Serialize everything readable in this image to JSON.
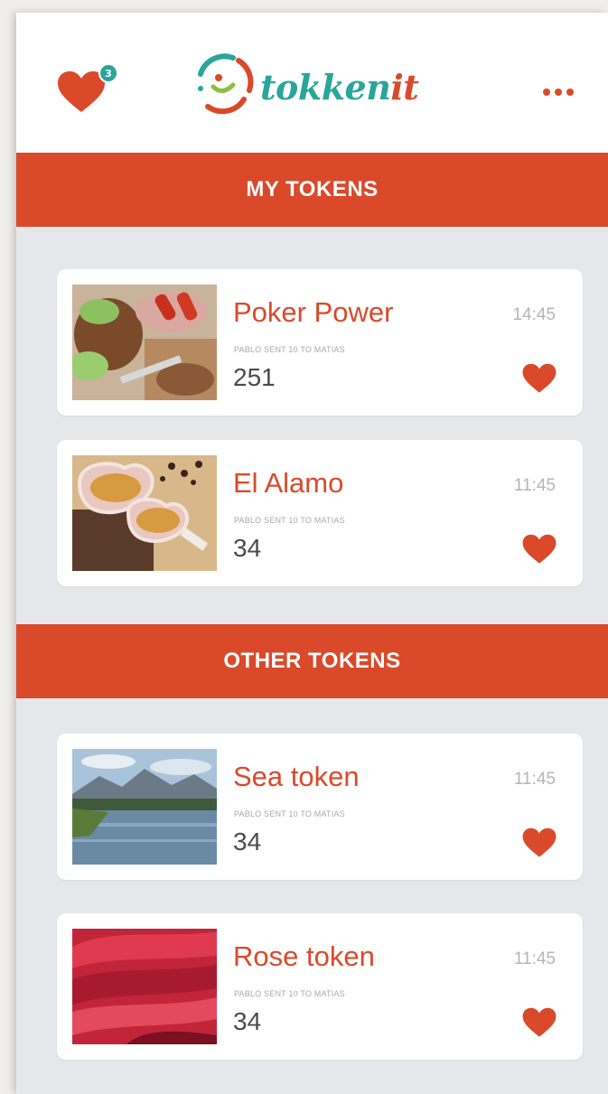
{
  "header": {
    "favorites_count": "3",
    "logo_text_main": "tokken",
    "logo_text_accent": "it",
    "icons": {
      "favorites": "heart-icon",
      "menu": "more-dots-icon"
    },
    "colors": {
      "accent": "#d9492a",
      "teal": "#2aa59a"
    }
  },
  "sections": {
    "my_tokens_label": "MY TOKENS",
    "other_tokens_label": "OTHER TOKENS"
  },
  "cards": [
    {
      "title": "Poker Power",
      "time": "14:45",
      "subtitle": "PABLO SENT 10 TO MATIAS",
      "count": "251"
    },
    {
      "title": "El Alamo",
      "time": "11:45",
      "subtitle": "PABLO SENT 10 TO MATIAS",
      "count": "34"
    },
    {
      "title": "Sea token",
      "time": "11:45",
      "subtitle": "PABLO SENT 10 TO MATIAS",
      "count": "34"
    },
    {
      "title": "Rose token",
      "time": "11:45",
      "subtitle": "PABLO SENT 10 TO MATIAS",
      "count": "34"
    }
  ]
}
